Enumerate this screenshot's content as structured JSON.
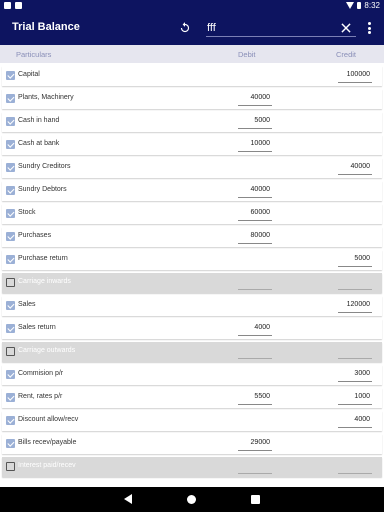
{
  "status_bar": {
    "time": "8:32",
    "left_icons": [
      "android-icon",
      "notification-icon"
    ],
    "right_icons": [
      "wifi-icon",
      "battery-icon"
    ]
  },
  "app_bar": {
    "title": "Trial Balance",
    "search_value": "fff",
    "icons": [
      "refresh-icon",
      "close-icon",
      "more-vert-icon"
    ]
  },
  "table": {
    "headers": {
      "particulars": "Particulars",
      "debit": "Debit",
      "credit": "Credit"
    },
    "rows": [
      {
        "label": "Capital",
        "checked": true,
        "debit": "",
        "credit": "100000"
      },
      {
        "label": "Plants, Machinery",
        "checked": true,
        "debit": "40000",
        "credit": ""
      },
      {
        "label": "Cash in hand",
        "checked": true,
        "debit": "5000",
        "credit": ""
      },
      {
        "label": "Cash at bank",
        "checked": true,
        "debit": "10000",
        "credit": ""
      },
      {
        "label": "Sundry Creditors",
        "checked": true,
        "debit": "",
        "credit": "40000"
      },
      {
        "label": "Sundry Debtors",
        "checked": true,
        "debit": "40000",
        "credit": ""
      },
      {
        "label": "Stock",
        "checked": true,
        "debit": "60000",
        "credit": ""
      },
      {
        "label": "Purchases",
        "checked": true,
        "debit": "80000",
        "credit": ""
      },
      {
        "label": "Purchase return",
        "checked": true,
        "debit": "",
        "credit": "5000"
      },
      {
        "label": "Carriage inwards",
        "checked": false,
        "debit": "",
        "credit": ""
      },
      {
        "label": "Sales",
        "checked": true,
        "debit": "",
        "credit": "120000"
      },
      {
        "label": "Sales return",
        "checked": true,
        "debit": "4000",
        "credit": ""
      },
      {
        "label": "Carriage outwards",
        "checked": false,
        "debit": "",
        "credit": ""
      },
      {
        "label": "Commision p/r",
        "checked": true,
        "debit": "",
        "credit": "3000"
      },
      {
        "label": "Rent, rates p/r",
        "checked": true,
        "debit": "5500",
        "credit": "1000"
      },
      {
        "label": "Discount allow/recv",
        "checked": true,
        "debit": "",
        "credit": "4000"
      },
      {
        "label": "Bills recev/payable",
        "checked": true,
        "debit": "29000",
        "credit": ""
      },
      {
        "label": "Interest paid/recev",
        "checked": false,
        "debit": "",
        "credit": ""
      }
    ]
  },
  "nav_bar": {
    "icons": [
      "back-icon",
      "home-icon",
      "recents-icon"
    ]
  },
  "colors": {
    "primary": "#0d1460",
    "checkbox": "#9bb0d6",
    "disabled_row": "#d9d9d9",
    "header_bg": "#e6e6ef"
  }
}
